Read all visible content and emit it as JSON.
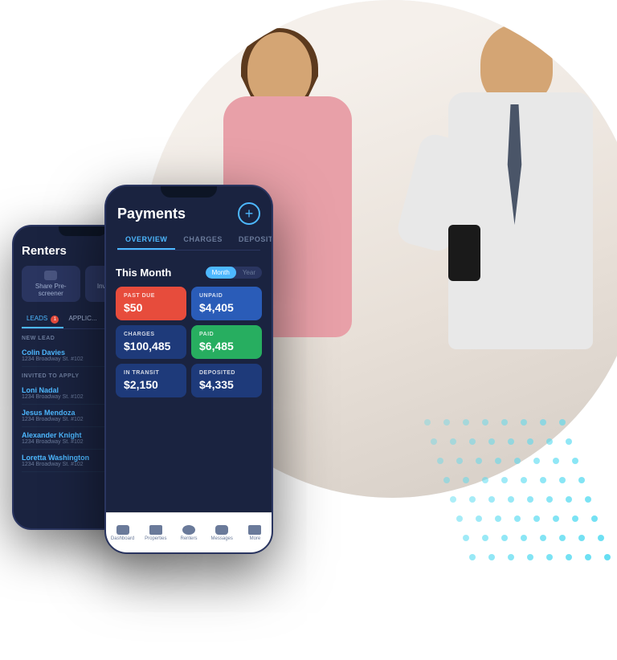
{
  "background": {
    "circle_color": "#f0f4f8"
  },
  "phone_renters": {
    "title": "Renters",
    "buttons": [
      {
        "icon": "share-icon",
        "label": "Share\nPre-screener"
      },
      {
        "icon": "invite-icon",
        "label": "Invite\nApp..."
      }
    ],
    "tabs": [
      {
        "label": "LEADS",
        "badge": "1",
        "active": true
      },
      {
        "label": "APPLIC..."
      }
    ],
    "sections": [
      {
        "section_label": "NEW LEAD",
        "leads": [
          {
            "name": "Colin Davies",
            "address": "1234 Broadway St. #102"
          }
        ]
      },
      {
        "section_label": "INVITED TO APPLY",
        "leads": [
          {
            "name": "Loni Nadal",
            "address": "1234 Broadway St. #102"
          },
          {
            "name": "Jesus Mendoza",
            "address": "1234 Broadway St. #102"
          },
          {
            "name": "Alexander Knight",
            "address": "1234 Broadway St. #102"
          },
          {
            "name": "Loretta Washington",
            "address": "1234 Broadway St. #102"
          }
        ]
      }
    ]
  },
  "phone_payments": {
    "title": "Payments",
    "tabs": [
      {
        "label": "OVERVIEW",
        "active": true
      },
      {
        "label": "CHARGES"
      },
      {
        "label": "DEPOSITS"
      }
    ],
    "period_label": "This Month",
    "toggle": {
      "month": "Month",
      "year": "Year",
      "active": "month"
    },
    "cards": [
      {
        "type": "past-due",
        "label": "PAST DUE",
        "value": "$50"
      },
      {
        "type": "unpaid",
        "label": "UNPAID",
        "value": "$4,405"
      },
      {
        "type": "charges",
        "label": "CHARGES",
        "value": "$100,485"
      },
      {
        "type": "paid",
        "label": "PAID",
        "value": "$6,485"
      },
      {
        "type": "in-transit",
        "label": "IN TRANSIT",
        "value": "$2,150"
      },
      {
        "type": "deposited",
        "label": "DEPOSITED",
        "value": "$4,335"
      }
    ],
    "nav": [
      {
        "label": "Dashboard"
      },
      {
        "label": "Properties"
      },
      {
        "label": "Renters"
      },
      {
        "label": "Messages"
      },
      {
        "label": "More"
      }
    ]
  },
  "dots": {
    "color": "#4dd9f0",
    "rows": 8,
    "cols": 8
  }
}
